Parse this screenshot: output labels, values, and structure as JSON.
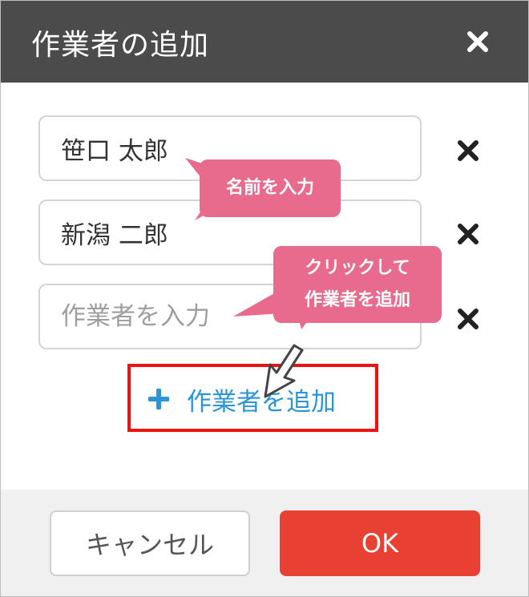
{
  "dialog": {
    "title": "作業者の追加",
    "close_icon": "close-icon"
  },
  "workers": [
    {
      "value": "笹口 太郎",
      "placeholder": ""
    },
    {
      "value": "新潟 二郎",
      "placeholder": ""
    },
    {
      "value": "",
      "placeholder": "作業者を入力"
    }
  ],
  "add_link": {
    "label": "作業者を追加",
    "icon": "plus-icon"
  },
  "callouts": {
    "name_hint": "名前を入力",
    "add_hint_line1": "クリックして",
    "add_hint_line2": "作業者を追加"
  },
  "footer": {
    "cancel_label": "キャンセル",
    "ok_label": "OK"
  },
  "colors": {
    "header_bg": "#4b4b4b",
    "ok_button": "#e84133",
    "link": "#2b95d6",
    "callout": "#e86b8d",
    "highlight_box": "#ee1111"
  }
}
